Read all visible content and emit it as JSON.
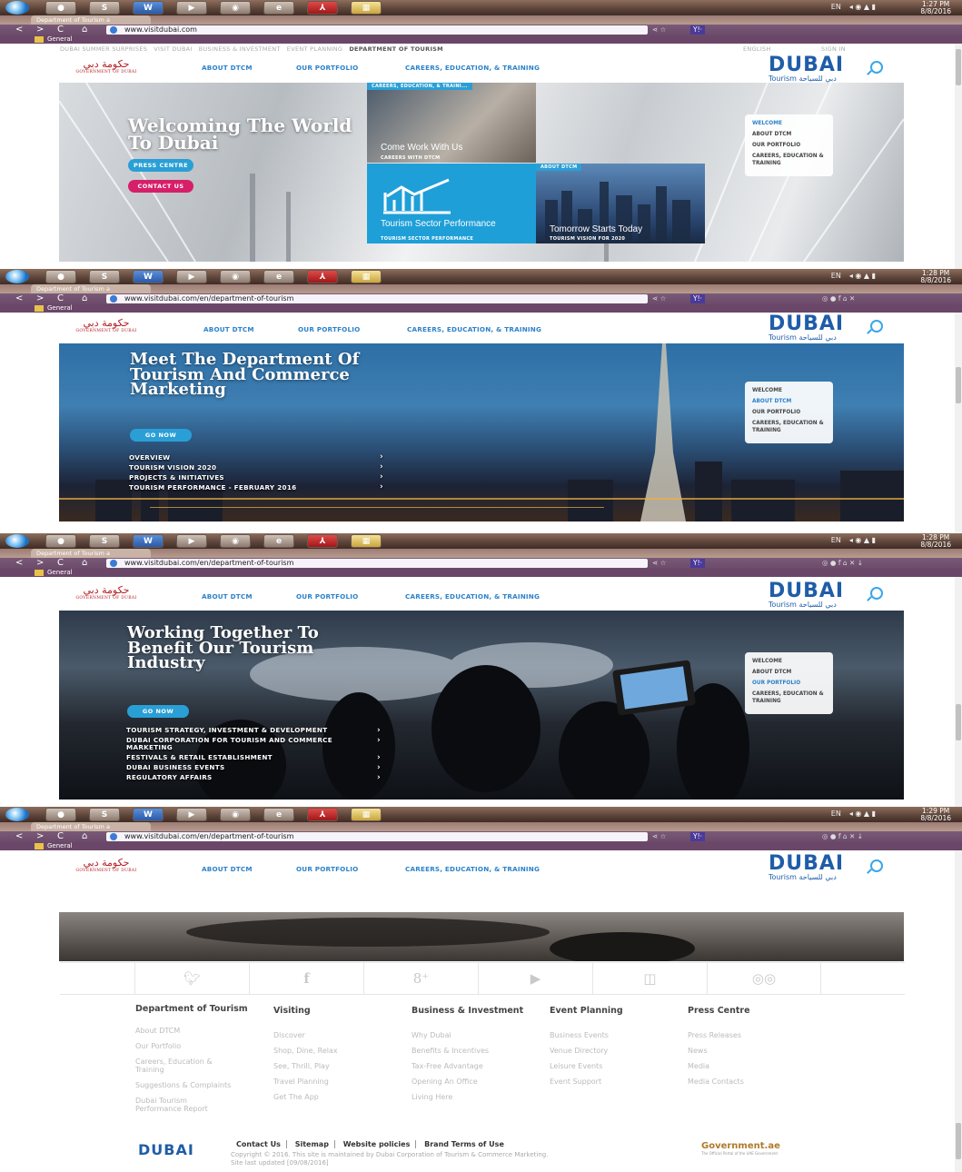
{
  "browser": {
    "tab_title": "Department of Tourism a",
    "url": "www.visitdubai.com/en/department-of-tourism",
    "url_first": "www.visitdubai.com",
    "bookmark_folder": "General",
    "nav": {
      "back": "<",
      "forward": ">",
      "reload": "C",
      "home": "⌂"
    },
    "lang_indicator": "EN",
    "clocks": [
      {
        "time": "1:27 PM",
        "date": "8/8/2016"
      },
      {
        "time": "1:28 PM",
        "date": "8/8/2016"
      },
      {
        "time": "1:28 PM",
        "date": "8/8/2016"
      },
      {
        "time": "1:29 PM",
        "date": "8/8/2016"
      }
    ]
  },
  "utility_bar": {
    "items": [
      "DUBAI SUMMER SURPRISES",
      "VISIT DUBAI",
      "BUSINESS & INVESTMENT",
      "EVENT PLANNING"
    ],
    "active": "DEPARTMENT OF TOURISM",
    "language": "ENGLISH",
    "sign_in": "SIGN IN"
  },
  "header": {
    "gov_logo_text": "GOVERNMENT OF DUBAI",
    "nav": [
      "ABOUT DTCM",
      "OUR PORTFOLIO",
      "CAREERS, EDUCATION, & TRAINING"
    ],
    "logo_word": "DUBAI",
    "logo_sub": "Tourism"
  },
  "slide1": {
    "title": "Welcoming The World To Dubai",
    "buttons": [
      "PRESS CENTRE",
      "CONTACT US"
    ],
    "tiles": [
      {
        "badge": "CAREERS, EDUCATION, & TRAINI...",
        "caption": "Come Work With Us",
        "sub": "CAREERS WITH DTCM"
      },
      {
        "badge": "",
        "caption": "Tourism Sector Performance",
        "sub": "TOURISM SECTOR PERFORMANCE"
      },
      {
        "badge": "ABOUT DTCM",
        "caption": "Tomorrow Starts Today",
        "sub": "TOURISM VISION FOR 2020"
      }
    ]
  },
  "side_menu": [
    "WELCOME",
    "ABOUT DTCM",
    "OUR PORTFOLIO",
    "CAREERS, EDUCATION & TRAINING"
  ],
  "slide2": {
    "title": "Meet The Department Of Tourism And Commerce Marketing",
    "button": "GO NOW",
    "links": [
      "OVERVIEW",
      "TOURISM VISION 2020",
      "PROJECTS & INITIATIVES",
      "TOURISM PERFORMANCE - FEBRUARY 2016"
    ]
  },
  "slide3": {
    "title": "Working Together To Benefit Our Tourism Industry",
    "button": "GO NOW",
    "links": [
      "TOURISM STRATEGY, INVESTMENT & DEVELOPMENT",
      "DUBAI CORPORATION FOR TOURISM AND COMMERCE MARKETING",
      "FESTIVALS & RETAIL ESTABLISHMENT",
      "DUBAI BUSINESS EVENTS",
      "REGULATORY AFFAIRS"
    ]
  },
  "footer": {
    "social_icons": [
      "twitter-icon",
      "facebook-icon",
      "google-plus-icon",
      "youtube-icon",
      "instagram-icon",
      "tripadvisor-icon"
    ],
    "columns": [
      {
        "heading": "Department of Tourism",
        "links": [
          "About DTCM",
          "Our Portfolio",
          "Careers, Education & Training",
          "Suggestions & Complaints",
          "Dubai Tourism Performance Report"
        ]
      },
      {
        "heading": "Visiting",
        "links": [
          "Discover",
          "Shop, Dine, Relax",
          "See, Thrill, Play",
          "Travel Planning",
          "Get The App"
        ]
      },
      {
        "heading": "Business & Investment",
        "links": [
          "Why Dubai",
          "Benefits & Incentives",
          "Tax-Free Advantage",
          "Opening An Office",
          "Living Here"
        ]
      },
      {
        "heading": "Event Planning",
        "links": [
          "Business Events",
          "Venue Directory",
          "Leisure Events",
          "Event Support"
        ]
      },
      {
        "heading": "Press Centre",
        "links": [
          "Press Releases",
          "News",
          "Media",
          "Media Contacts"
        ]
      }
    ],
    "bottom_links": [
      "Contact Us",
      "Sitemap",
      "Website policies",
      "Brand Terms of Use"
    ],
    "copyright": "Copyright © 2016. This site is maintained by Dubai Corporation of Tourism & Commerce Marketing.",
    "updated": "Site last updated [09/08/2016]",
    "gov_ae": "Government.ae",
    "gov_ae_sub": "The Official Portal of the UAE Government"
  }
}
